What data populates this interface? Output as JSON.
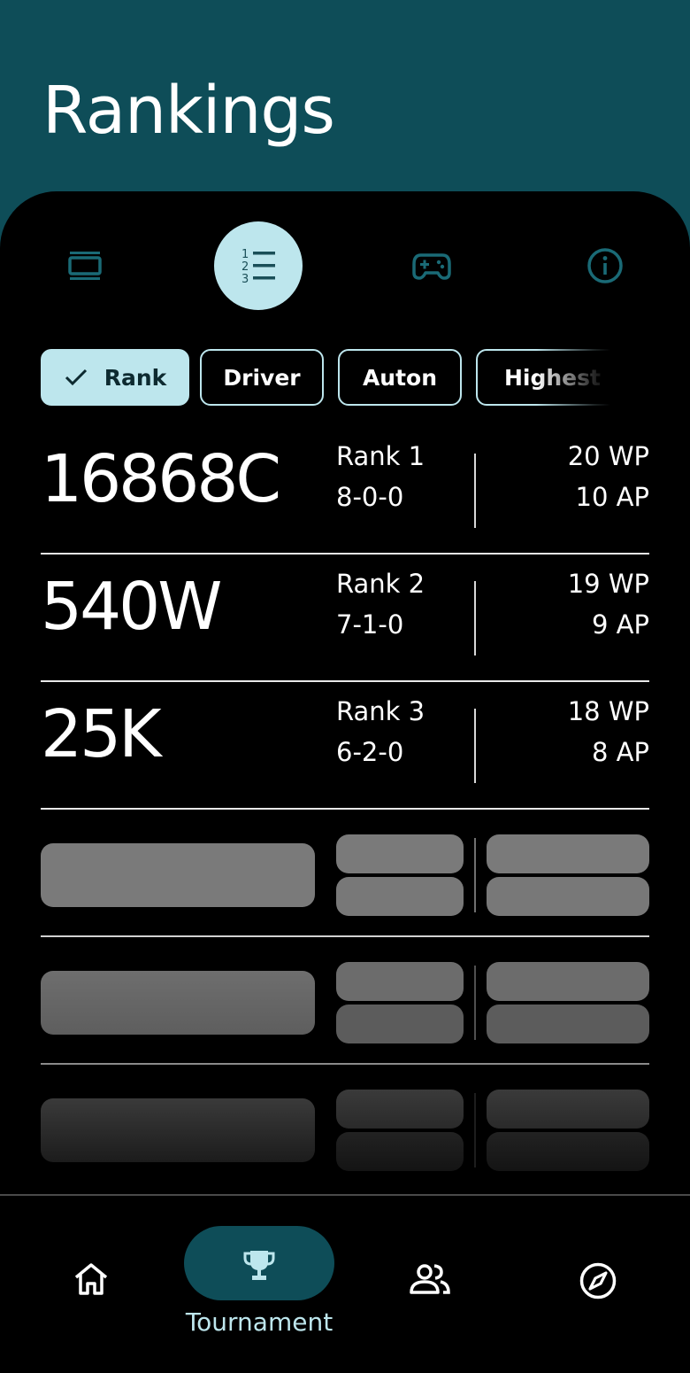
{
  "header": {
    "title": "Rankings"
  },
  "tabs": [
    {
      "icon": "event-list-icon",
      "active": false
    },
    {
      "icon": "ranked-list-icon",
      "active": true
    },
    {
      "icon": "gamepad-icon",
      "active": false
    },
    {
      "icon": "info-icon",
      "active": false
    }
  ],
  "chips": {
    "rank": "Rank",
    "driver": "Driver",
    "auton": "Auton",
    "highest": "Highest"
  },
  "rankings": [
    {
      "team": "16868C",
      "rank": "Rank 1",
      "record": "8-0-0",
      "wp": "20 WP",
      "ap": "10 AP"
    },
    {
      "team": "540W",
      "rank": "Rank 2",
      "record": "7-1-0",
      "wp": "19 WP",
      "ap": "9 AP"
    },
    {
      "team": "25K",
      "rank": "Rank 3",
      "record": "6-2-0",
      "wp": "18 WP",
      "ap": "8 AP"
    }
  ],
  "bottom_nav": {
    "items": [
      {
        "icon": "home-icon"
      },
      {
        "icon": "trophy-icon",
        "label": "Tournament",
        "active": true
      },
      {
        "icon": "people-icon"
      },
      {
        "icon": "compass-icon"
      }
    ]
  },
  "colors": {
    "header_bg": "#0e4d58",
    "accent_light": "#bde6ed",
    "background": "#000000"
  }
}
